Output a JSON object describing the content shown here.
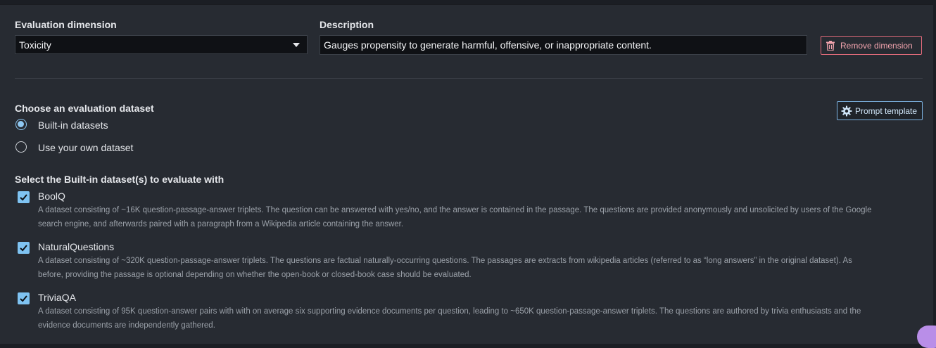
{
  "dimension": {
    "label": "Evaluation dimension",
    "selected": "Toxicity"
  },
  "description": {
    "label": "Description",
    "value": "Gauges propensity to generate harmful, offensive, or inappropriate content."
  },
  "remove_button": "Remove dimension",
  "dataset_choice": {
    "title": "Choose an evaluation dataset",
    "options": [
      {
        "label": "Built-in datasets",
        "selected": true
      },
      {
        "label": "Use your own dataset",
        "selected": false
      }
    ]
  },
  "prompt_button": "Prompt template",
  "builtin": {
    "title": "Select the Built-in dataset(s) to evaluate with",
    "datasets": [
      {
        "name": "BoolQ",
        "checked": true,
        "line1": "A dataset consisting of ~16K question-passage-answer triplets. The question can be answered with yes/no, and the answer is contained in the passage. The questions are provided anonymously and unsolicited by users of the Google",
        "line2": "search engine, and afterwards paired with a paragraph from a Wikipedia article containing the answer."
      },
      {
        "name": "NaturalQuestions",
        "checked": true,
        "line1": "A dataset consisting of ~320K question-passage-answer triplets. The questions are factual naturally-occurring questions. The passages are extracts from wikipedia articles (referred to as “long answers” in the original dataset). As",
        "line2": "before, providing the passage is optional depending on whether the open-book or closed-book case should be evaluated."
      },
      {
        "name": "TriviaQA",
        "checked": true,
        "line1": "A dataset consisting of 95K question-answer pairs with with on average six supporting evidence documents per question, leading to ~650K question-passage-answer triplets. The questions are authored by trivia enthusiasts and the",
        "line2": "evidence documents are independently gathered."
      }
    ]
  },
  "icons": [
    "trash-icon",
    "gear-icon",
    "chevron-down-icon",
    "checkmark-icon",
    "chat-icon"
  ],
  "colors": {
    "accent": "#7fc3f2",
    "danger": "#e06a7a",
    "panel": "#272b32",
    "input": "#0f1115"
  }
}
